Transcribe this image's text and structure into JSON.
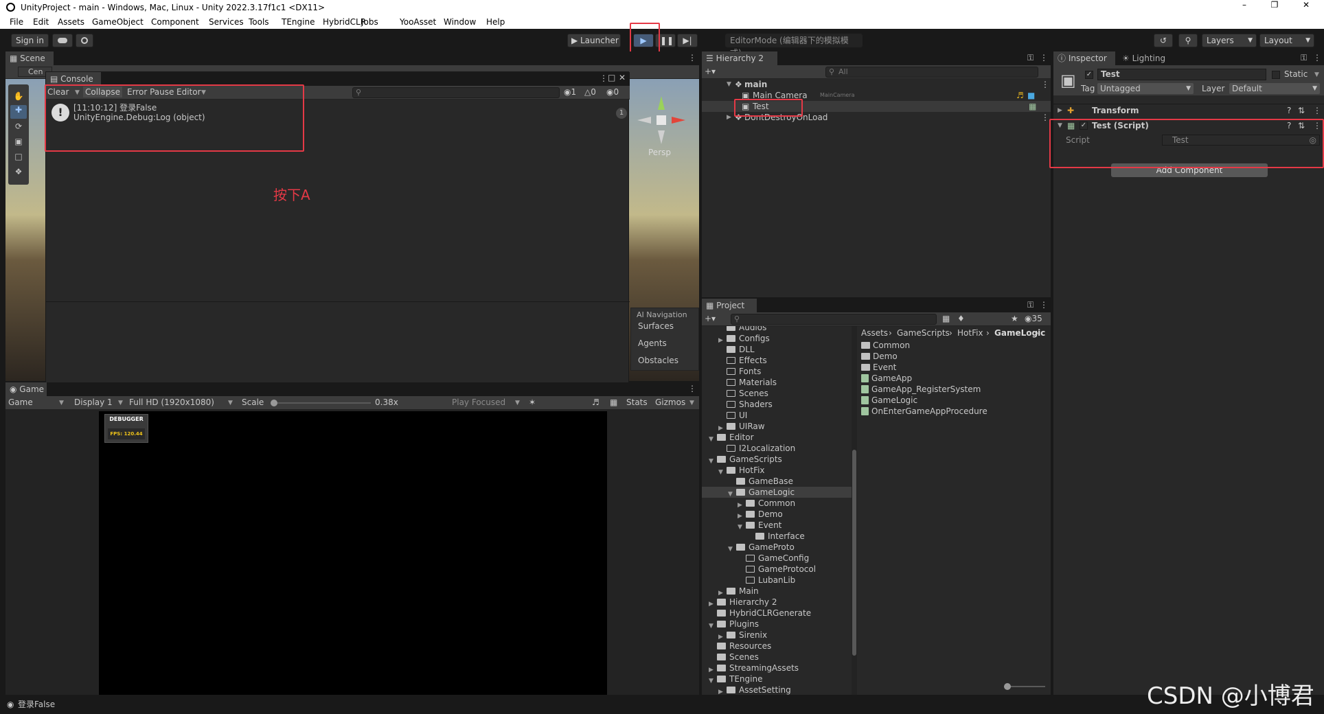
{
  "window": {
    "title": "UnityProject - main - Windows, Mac, Linux - Unity 2022.3.17f1c1 <DX11>"
  },
  "menu": [
    "File",
    "Edit",
    "Assets",
    "GameObject",
    "Component",
    "Services",
    "Tools",
    "TEngine",
    "HybridCLR",
    "Jobs",
    "YooAsset",
    "Window",
    "Help"
  ],
  "toolbar": {
    "sign_in": "Sign in",
    "launcher": "Launcher",
    "editor_mode": "EditorMode (编辑器下的模拟模式)",
    "layers": "Layers",
    "layout": "Layout"
  },
  "scene": {
    "tab": "Scene",
    "center_label": "Cen",
    "persp": "Persp",
    "ai_navigation": "AI Navigation",
    "surfaces": "Surfaces",
    "agents": "Agents",
    "obstacles": "Obstacles"
  },
  "console": {
    "tab": "Console",
    "clear": "Clear",
    "collapse": "Collapse",
    "error_pause": "Error Pause",
    "editor": "Editor",
    "count_info": "1",
    "count_warn": "0",
    "count_error": "0",
    "log_line1": "[11:10:12] 登录False",
    "log_line2": "UnityEngine.Debug:Log (object)",
    "log_count": "1"
  },
  "annotation": "按下A",
  "game": {
    "tab": "Game",
    "mode": "Game",
    "display": "Display 1",
    "resolution": "Full HD (1920x1080)",
    "scale_label": "Scale",
    "scale_value": "0.38x",
    "play_focused": "Play Focused",
    "stats": "Stats",
    "gizmos": "Gizmos",
    "debugger": "DEBUGGER",
    "fps": "FPS: 120.44"
  },
  "hierarchy": {
    "tab": "Hierarchy 2",
    "search_placeholder": "All",
    "items": [
      {
        "label": "main",
        "level": 0
      },
      {
        "label": "Main Camera",
        "tag": "MainCamera",
        "level": 1
      },
      {
        "label": "Test",
        "level": 1
      },
      {
        "label": "DontDestroyOnLoad",
        "level": 0
      }
    ]
  },
  "inspector": {
    "tab": "Inspector",
    "lighting_tab": "Lighting",
    "object_name": "Test",
    "static_label": "Static",
    "tag_label": "Tag",
    "tag_value": "Untagged",
    "layer_label": "Layer",
    "layer_value": "Default",
    "transform": "Transform",
    "script_component": "Test (Script)",
    "script_label": "Script",
    "script_value": "Test",
    "add_component": "Add Component"
  },
  "project": {
    "tab": "Project",
    "hidden_count": "35",
    "breadcrumb": [
      "Assets",
      "GameScripts",
      "HotFix",
      "GameLogic"
    ],
    "tree": [
      {
        "label": "Audios",
        "indent": 2,
        "arrow": false,
        "open": false
      },
      {
        "label": "Configs",
        "indent": 2,
        "arrow": true,
        "open": false
      },
      {
        "label": "DLL",
        "indent": 2,
        "arrow": false,
        "open": false
      },
      {
        "label": "Effects",
        "indent": 2,
        "arrow": false,
        "open": true
      },
      {
        "label": "Fonts",
        "indent": 2,
        "arrow": false,
        "open": true
      },
      {
        "label": "Materials",
        "indent": 2,
        "arrow": false,
        "open": true
      },
      {
        "label": "Scenes",
        "indent": 2,
        "arrow": false,
        "open": true
      },
      {
        "label": "Shaders",
        "indent": 2,
        "arrow": false,
        "open": true
      },
      {
        "label": "UI",
        "indent": 2,
        "arrow": false,
        "open": true
      },
      {
        "label": "UIRaw",
        "indent": 2,
        "arrow": true,
        "open": false
      },
      {
        "label": "Editor",
        "indent": 1,
        "arrow": "down",
        "open": false
      },
      {
        "label": "I2Localization",
        "indent": 2,
        "arrow": false,
        "open": true
      },
      {
        "label": "GameScripts",
        "indent": 1,
        "arrow": "down",
        "open": false
      },
      {
        "label": "HotFix",
        "indent": 2,
        "arrow": "down",
        "open": false
      },
      {
        "label": "GameBase",
        "indent": 3,
        "arrow": false,
        "open": false
      },
      {
        "label": "GameLogic",
        "indent": 3,
        "arrow": "down",
        "open": false,
        "selected": true
      },
      {
        "label": "Common",
        "indent": 4,
        "arrow": true,
        "open": false
      },
      {
        "label": "Demo",
        "indent": 4,
        "arrow": true,
        "open": false
      },
      {
        "label": "Event",
        "indent": 4,
        "arrow": "down",
        "open": false
      },
      {
        "label": "Interface",
        "indent": 5,
        "arrow": false,
        "open": false
      },
      {
        "label": "GameProto",
        "indent": 3,
        "arrow": "down",
        "open": false
      },
      {
        "label": "GameConfig",
        "indent": 4,
        "arrow": false,
        "open": true
      },
      {
        "label": "GameProtocol",
        "indent": 4,
        "arrow": false,
        "open": true
      },
      {
        "label": "LubanLib",
        "indent": 4,
        "arrow": false,
        "open": true
      },
      {
        "label": "Main",
        "indent": 2,
        "arrow": true,
        "open": false
      },
      {
        "label": "Hierarchy 2",
        "indent": 1,
        "arrow": true,
        "open": false
      },
      {
        "label": "HybridCLRGenerate",
        "indent": 1,
        "arrow": false,
        "open": false
      },
      {
        "label": "Plugins",
        "indent": 1,
        "arrow": "down",
        "open": false
      },
      {
        "label": "Sirenix",
        "indent": 2,
        "arrow": true,
        "open": false
      },
      {
        "label": "Resources",
        "indent": 1,
        "arrow": false,
        "open": false
      },
      {
        "label": "Scenes",
        "indent": 1,
        "arrow": false,
        "open": false
      },
      {
        "label": "StreamingAssets",
        "indent": 1,
        "arrow": true,
        "open": false
      },
      {
        "label": "TEngine",
        "indent": 1,
        "arrow": "down",
        "open": false
      },
      {
        "label": "AssetSetting",
        "indent": 2,
        "arrow": true,
        "open": false
      }
    ],
    "files": [
      {
        "label": "Common",
        "type": "folder"
      },
      {
        "label": "Demo",
        "type": "folder"
      },
      {
        "label": "Event",
        "type": "folder"
      },
      {
        "label": "GameApp",
        "type": "script"
      },
      {
        "label": "GameApp_RegisterSystem",
        "type": "script"
      },
      {
        "label": "GameLogic",
        "type": "script"
      },
      {
        "label": "OnEnterGameAppProcedure",
        "type": "script"
      }
    ]
  },
  "status_bar": "登录False",
  "watermark": "CSDN @小博君"
}
